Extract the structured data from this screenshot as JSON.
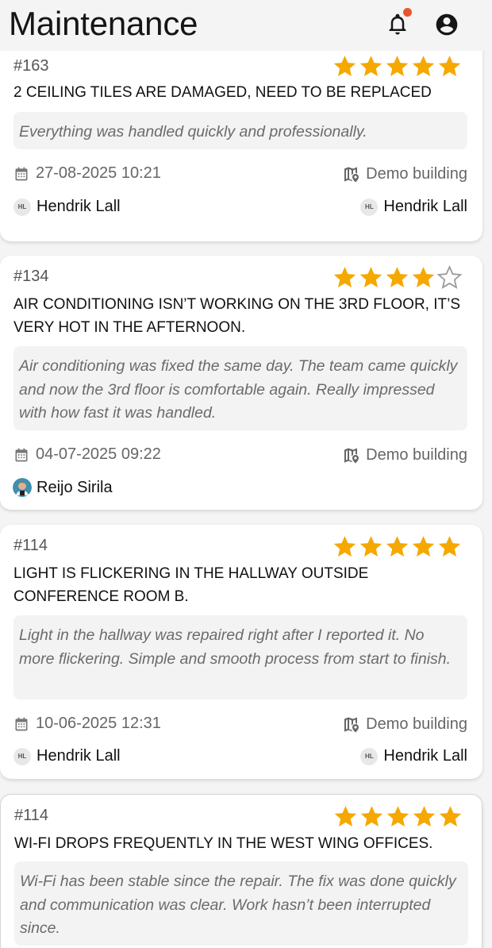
{
  "header": {
    "title": "Maintenance",
    "notification_icon": "bell-icon",
    "account_icon": "account-circle-icon",
    "notification_dot_color": "#e8562f"
  },
  "colors": {
    "star_filled": "#f5a800",
    "star_empty": "#9a9a9a"
  },
  "cards": [
    {
      "id": "#163",
      "rating": 5,
      "title": "2 CEILING TILES ARE DAMAGED, NEED TO BE REPLACED",
      "feedback": "Everything was handled quickly and professionally.",
      "date": "27-08-2025 10:21",
      "building": "Demo building",
      "reporter": {
        "initials": "HL",
        "name": "Hendrik Lall"
      },
      "assignee": {
        "initials": "HL",
        "name": "Hendrik Lall"
      }
    },
    {
      "id": "#134",
      "rating": 4,
      "title": "AIR CONDITIONING ISN’T WORKING ON THE 3RD FLOOR, IT’S VERY HOT IN THE AFTERNOON.",
      "feedback": "Air conditioning was fixed the same day. The team came quickly and now the 3rd floor is comfortable again. Really impressed with how fast it was handled.",
      "date": "04-07-2025 09:22",
      "building": "Demo building",
      "reporter": {
        "name": "Reijo Sirila"
      }
    },
    {
      "id": "#114",
      "rating": 5,
      "title": "LIGHT IS FLICKERING IN THE HALLWAY OUTSIDE CONFERENCE ROOM B.",
      "feedback": "Light in the hallway was repaired right after I reported it. No more flickering. Simple and smooth process from start to finish.",
      "date": "10-06-2025 12:31",
      "building": "Demo building",
      "reporter": {
        "initials": "HL",
        "name": "Hendrik Lall"
      },
      "assignee": {
        "initials": "HL",
        "name": "Hendrik Lall"
      }
    },
    {
      "id": "#114",
      "rating": 5,
      "title": "WI-FI DROPS FREQUENTLY IN THE WEST WING OFFICES.",
      "feedback": "Wi-Fi has been stable since the repair. The fix was done quickly and communication was clear. Work hasn’t been interrupted since."
    }
  ]
}
